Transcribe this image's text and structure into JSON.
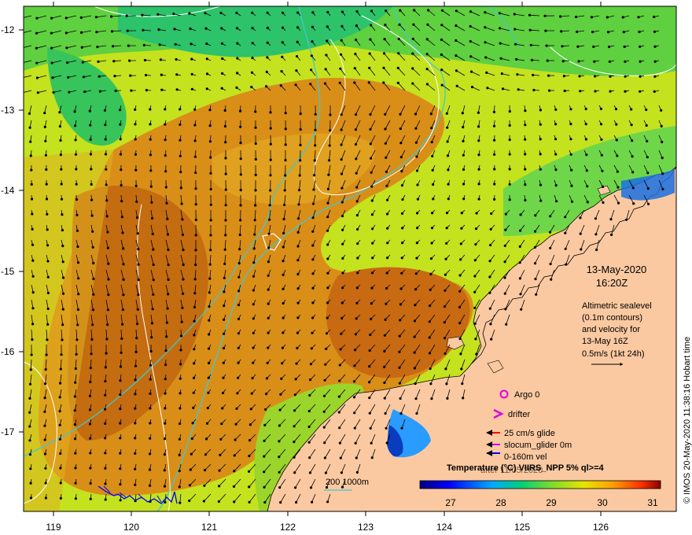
{
  "map": {
    "lon_ticks": [
      "119",
      "120",
      "121",
      "122",
      "123",
      "124",
      "125",
      "126"
    ],
    "lat_ticks": [
      "-12",
      "-13",
      "-14",
      "-15",
      "-16",
      "-17"
    ],
    "datetime_line1": "13-May-2020",
    "datetime_line2": "16:20Z",
    "altimetry_lines": [
      "Altimetric sealevel",
      "(0.1m contours)",
      "and velocity for",
      "13-May 16Z"
    ],
    "scale_label": "0.5m/s (1kt 24h)",
    "legend": {
      "argo": "Argo 0",
      "drifter": "drifter",
      "glide": "25 cm/s glide",
      "slocum": "slocum_glider 0m",
      "vel": "0-160m vel",
      "date_hidden": "after 11/05/2020"
    },
    "isobath_label": "200  1000m",
    "colorbar": {
      "title": "Temperature (°C) VIIRS_NPP 5% ql>=4",
      "ticks": [
        "27",
        "28",
        "29",
        "30",
        "31"
      ]
    },
    "credit": "© IMOS 20-May-2020 11:38:16 Hobart time",
    "colors": {
      "land": "#fbc9a1",
      "legend_argo": "#e000e0",
      "legend_drifter": "#e000e0",
      "legend_glide": "#ff0000",
      "legend_slocum": "#c000ff",
      "legend_vel": "#0000ff",
      "isobath": "#40c8d0",
      "contour": "#ffffff"
    }
  }
}
